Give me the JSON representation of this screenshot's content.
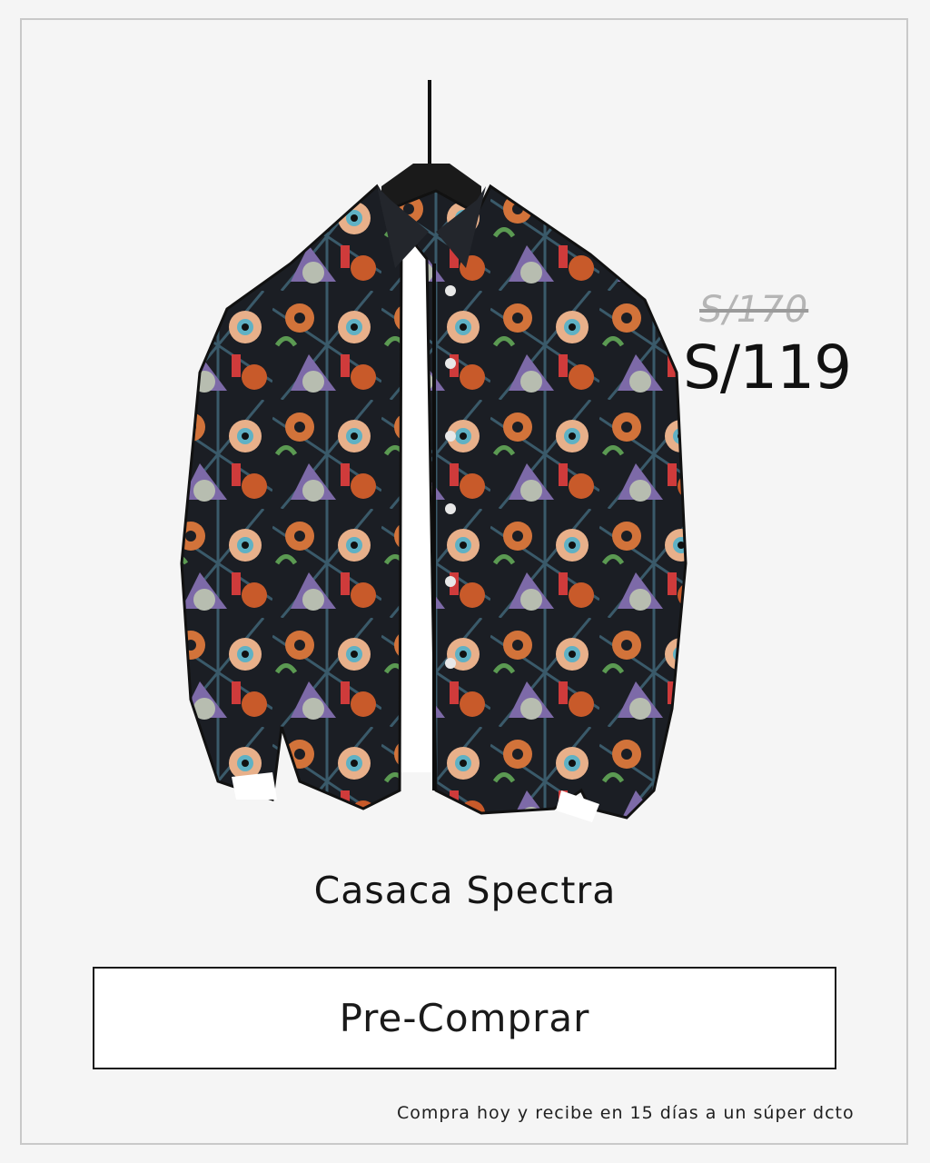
{
  "product": {
    "old_price": "S/170",
    "price": "S/119",
    "name": "Casaca Spectra",
    "image_icon": "halloween-print-jacket-image"
  },
  "actions": {
    "buy_label": "Pre-Comprar"
  },
  "footer": {
    "note": "Compra hoy y recibe en 15 días a un súper dcto"
  },
  "colors": {
    "background": "#f5f5f5",
    "border": "#c9c9c9",
    "text": "#111111",
    "old_price": "#b5b5b5"
  }
}
